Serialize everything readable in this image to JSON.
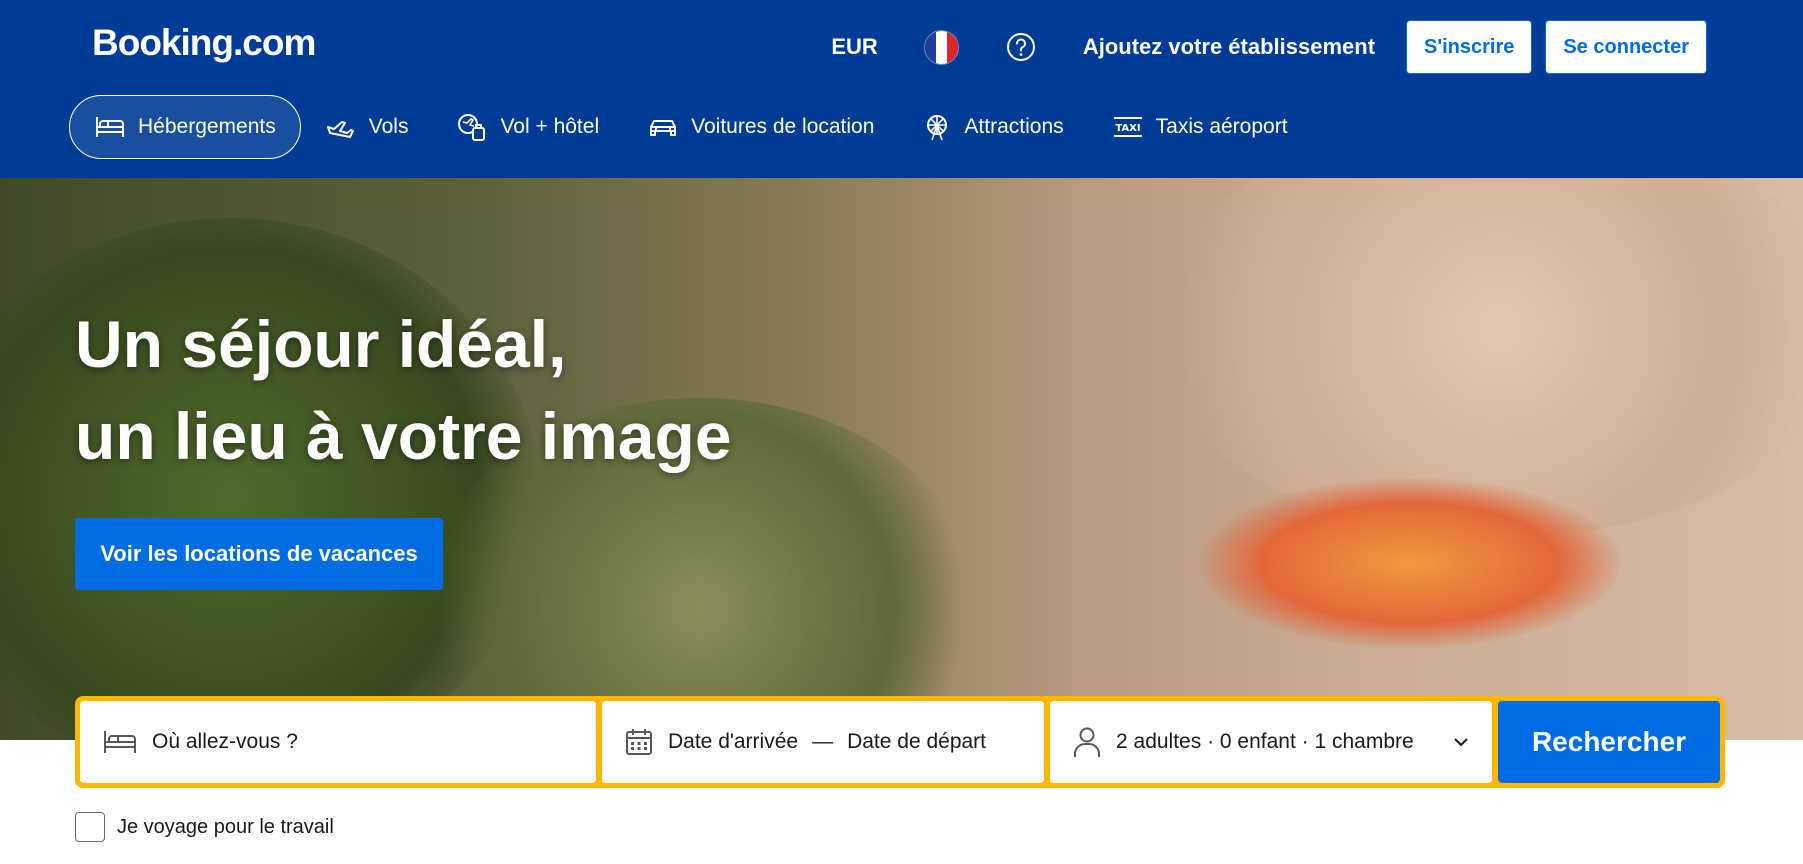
{
  "header": {
    "logo": "Booking.com",
    "currency": "EUR",
    "language_flag": "french-flag-icon",
    "help_icon": "help-icon",
    "add_property": "Ajoutez votre établissement",
    "register": "S'inscrire",
    "login": "Se connecter"
  },
  "nav": {
    "items": [
      {
        "label": "Hébergements",
        "icon": "bed-icon",
        "active": true
      },
      {
        "label": "Vols",
        "icon": "plane-icon",
        "active": false
      },
      {
        "label": "Vol + hôtel",
        "icon": "flight-hotel-icon",
        "active": false
      },
      {
        "label": "Voitures de location",
        "icon": "car-icon",
        "active": false
      },
      {
        "label": "Attractions",
        "icon": "ferris-wheel-icon",
        "active": false
      },
      {
        "label": "Taxis aéroport",
        "icon": "taxi-icon",
        "active": false
      }
    ]
  },
  "hero": {
    "title_line1": "Un séjour idéal,",
    "title_line2": "un lieu à votre image",
    "cta": "Voir les locations de vacances"
  },
  "search": {
    "destination_placeholder": "Où allez-vous ?",
    "checkin": "Date d'arrivée",
    "separator": "—",
    "checkout": "Date de départ",
    "occupancy": "2 adultes · 0 enfant · 1 chambre",
    "button": "Rechercher"
  },
  "business_travel": {
    "label": "Je voyage pour le travail",
    "checked": false
  },
  "colors": {
    "brand_dark": "#003b95",
    "brand_blue": "#006ce4",
    "search_border": "#ffb700"
  }
}
